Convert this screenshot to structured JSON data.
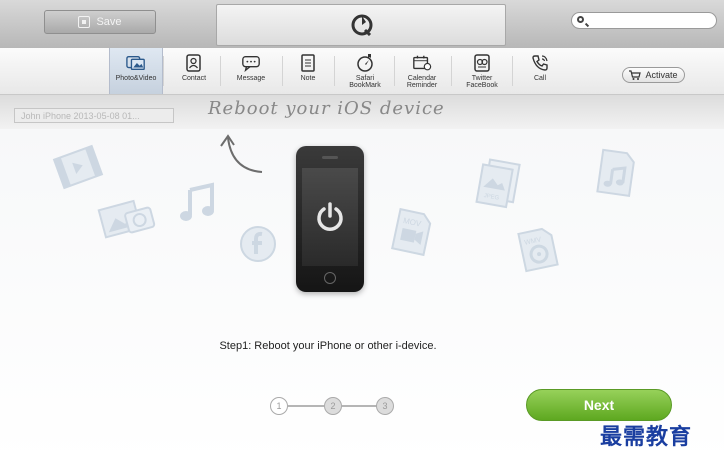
{
  "topbar": {
    "save_label": "Save",
    "search_placeholder": ""
  },
  "toolbar": {
    "items": [
      {
        "label": "Photo&Video",
        "icon": "photo-video-icon"
      },
      {
        "label": "Contact",
        "icon": "contact-icon"
      },
      {
        "label": "Message",
        "icon": "message-icon"
      },
      {
        "label": "Note",
        "icon": "note-icon"
      },
      {
        "label": "Safari BookMark",
        "icon": "safari-bookmark-icon"
      },
      {
        "label": "Calendar Reminder",
        "icon": "calendar-icon"
      },
      {
        "label": "Twitter FaceBook",
        "icon": "twitter-facebook-icon"
      },
      {
        "label": "Call",
        "icon": "call-icon"
      }
    ],
    "activate_label": "Activate"
  },
  "subbar": {
    "device_text": "John iPhone 2013-05-08 01..."
  },
  "main": {
    "handwritten_title": "Reboot your iOS device",
    "step_text": "Step1: Reboot your iPhone or other i-device.",
    "steps": [
      "1",
      "2",
      "3"
    ],
    "current_step": 1,
    "next_label": "Next"
  },
  "watermark": "最需教育",
  "colors": {
    "accent_green": "#6ab52a",
    "watermark_blue": "#1a3ea0"
  }
}
